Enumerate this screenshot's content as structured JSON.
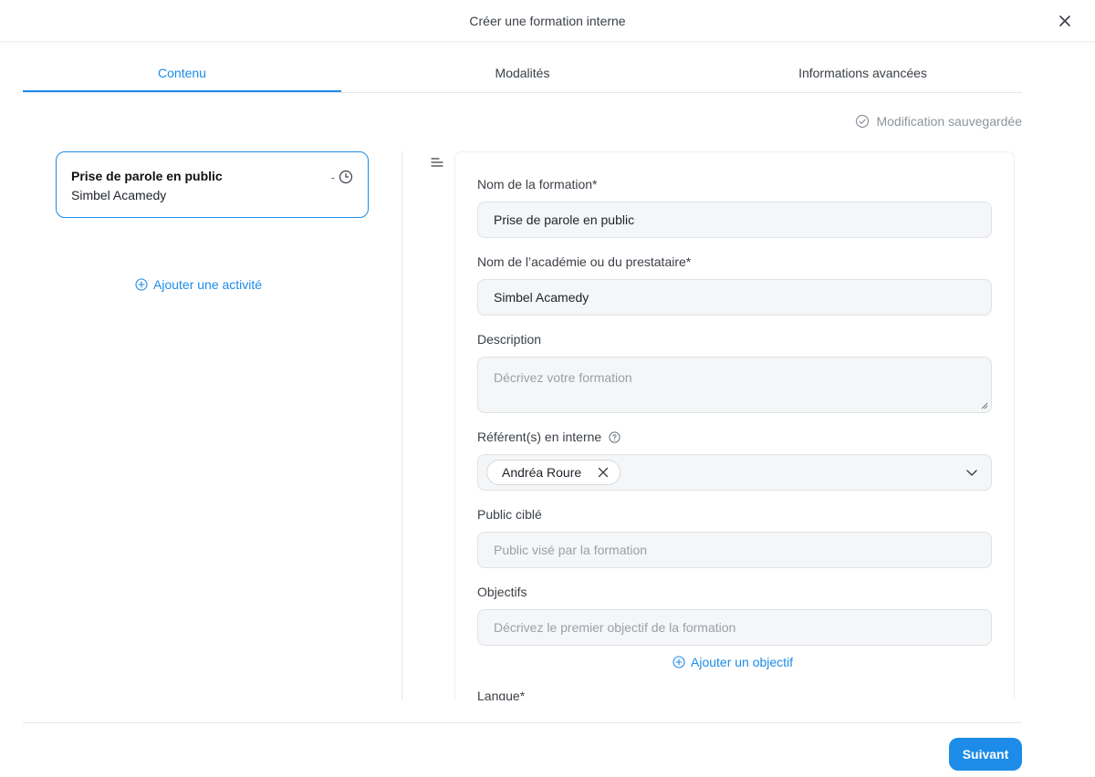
{
  "header": {
    "title": "Créer une formation interne"
  },
  "tabs": [
    {
      "label": "Contenu",
      "active": true
    },
    {
      "label": "Modalités",
      "active": false
    },
    {
      "label": "Informations avancées",
      "active": false
    }
  ],
  "status": {
    "saved_text": "Modification sauvegardée"
  },
  "activity": {
    "title": "Prise de parole en public",
    "subtitle": "Simbel Acamedy",
    "duration": "-"
  },
  "sidebar": {
    "add_activity_label": "Ajouter une activité"
  },
  "form": {
    "name_label": "Nom de la formation*",
    "name_value": "Prise de parole en public",
    "academy_label": "Nom de l’académie ou du prestataire*",
    "academy_value": "Simbel Acamedy",
    "description_label": "Description",
    "description_placeholder": "Décrivez votre formation",
    "referents_label": "Référent(s) en interne",
    "referent_chip": "Andréa Roure",
    "public_label": "Public ciblé",
    "public_placeholder": "Public visé par la formation",
    "objectives_label": "Objectifs",
    "objective_placeholder": "Décrivez le premier objectif de la formation",
    "add_objective_label": "Ajouter un objectif",
    "language_label": "Langue*"
  },
  "footer": {
    "next_label": "Suivant"
  },
  "colors": {
    "accent": "#1c8ce8",
    "input_bg": "#f4f6f8",
    "border": "#dfe2e6"
  }
}
